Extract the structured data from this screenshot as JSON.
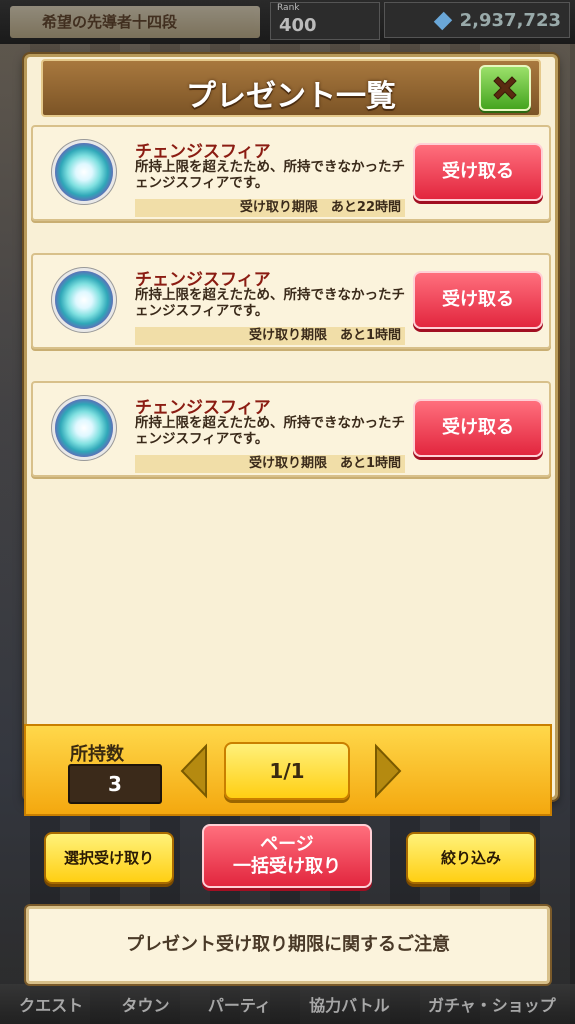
{
  "status_bar": {
    "rank_title": "希望の先導者十四段",
    "rank_label": "Rank",
    "rank_value": "400",
    "currency_value": "2,937,723"
  },
  "dialog": {
    "title": "プレゼント一覧",
    "items": [
      {
        "name": "チェンジスフィア",
        "description": "所持上限を超えたため、所持できなかったチェンジスフィアです。",
        "deadline": "受け取り期限　あと22時間",
        "button": "受け取る",
        "icon": "change-sphere-icon"
      },
      {
        "name": "チェンジスフィア",
        "description": "所持上限を超えたため、所持できなかったチェンジスフィアです。",
        "deadline": "受け取り期限　あと1時間",
        "button": "受け取る",
        "icon": "change-sphere-icon"
      },
      {
        "name": "チェンジスフィア",
        "description": "所持上限を超えたため、所持できなかったチェンジスフィアです。",
        "deadline": "受け取り期限　あと1時間",
        "button": "受け取る",
        "icon": "change-sphere-icon"
      }
    ]
  },
  "footer": {
    "owned_label": "所持数",
    "owned_value": "3",
    "page": "1/1"
  },
  "actions": {
    "select_receive": "選択受け取り",
    "page_receive_line1": "ページ",
    "page_receive_line2": "一括受け取り",
    "filter": "絞り込み"
  },
  "notice": "プレゼント受け取り期限に関するご注意",
  "bottom_nav": [
    "クエスト",
    "タウン",
    "パーティ",
    "協力バトル",
    "ガチャ・ショップ"
  ],
  "colors": {
    "accent_red": "#e2263e",
    "accent_yellow": "#ffcf13",
    "close_green": "#45a520"
  }
}
